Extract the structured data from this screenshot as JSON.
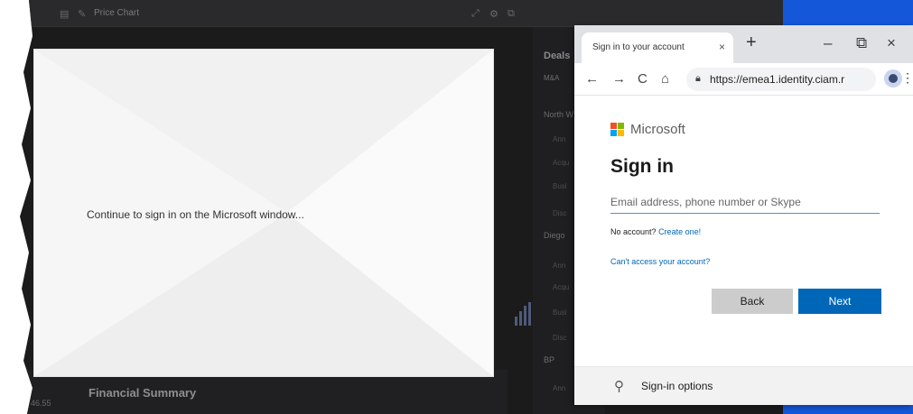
{
  "app": {
    "toolbar_title": "Price Chart",
    "deals_title": "Deals",
    "deals_tab": "M&A",
    "deals_groups": [
      "North W",
      "Diego",
      "BP"
    ],
    "deals_row_labels": [
      "Ann",
      "Acqu",
      "Busi",
      "Disc"
    ],
    "financial_summary": "Financial Summary",
    "price_value": "46.55"
  },
  "modal": {
    "message": "Continue to sign in on the Microsoft window..."
  },
  "browser": {
    "tab_title": "Sign in to your account",
    "tab_close": "×",
    "new_tab": "+",
    "minimize": "–",
    "restore": "⧉",
    "close": "×",
    "back": "←",
    "forward": "→",
    "reload": "C",
    "home": "⌂",
    "url": "https://emea1.identity.ciam.r",
    "menu": "⋮"
  },
  "signin": {
    "brand": "Microsoft",
    "heading": "Sign in",
    "email_placeholder": "Email address, phone number or Skype",
    "email_value": "",
    "no_account_text": "No account?",
    "create_link": "Create one!",
    "cant_access": "Can't access your account?",
    "back_label": "Back",
    "next_label": "Next",
    "options_label": "Sign-in options"
  },
  "colors": {
    "ms_red": "#f25022",
    "ms_green": "#7fba00",
    "ms_blue": "#00a4ef",
    "ms_yellow": "#ffb900",
    "accent": "#0067b8"
  },
  "icons": {
    "lock": "lock-icon",
    "key": "key-icon"
  }
}
